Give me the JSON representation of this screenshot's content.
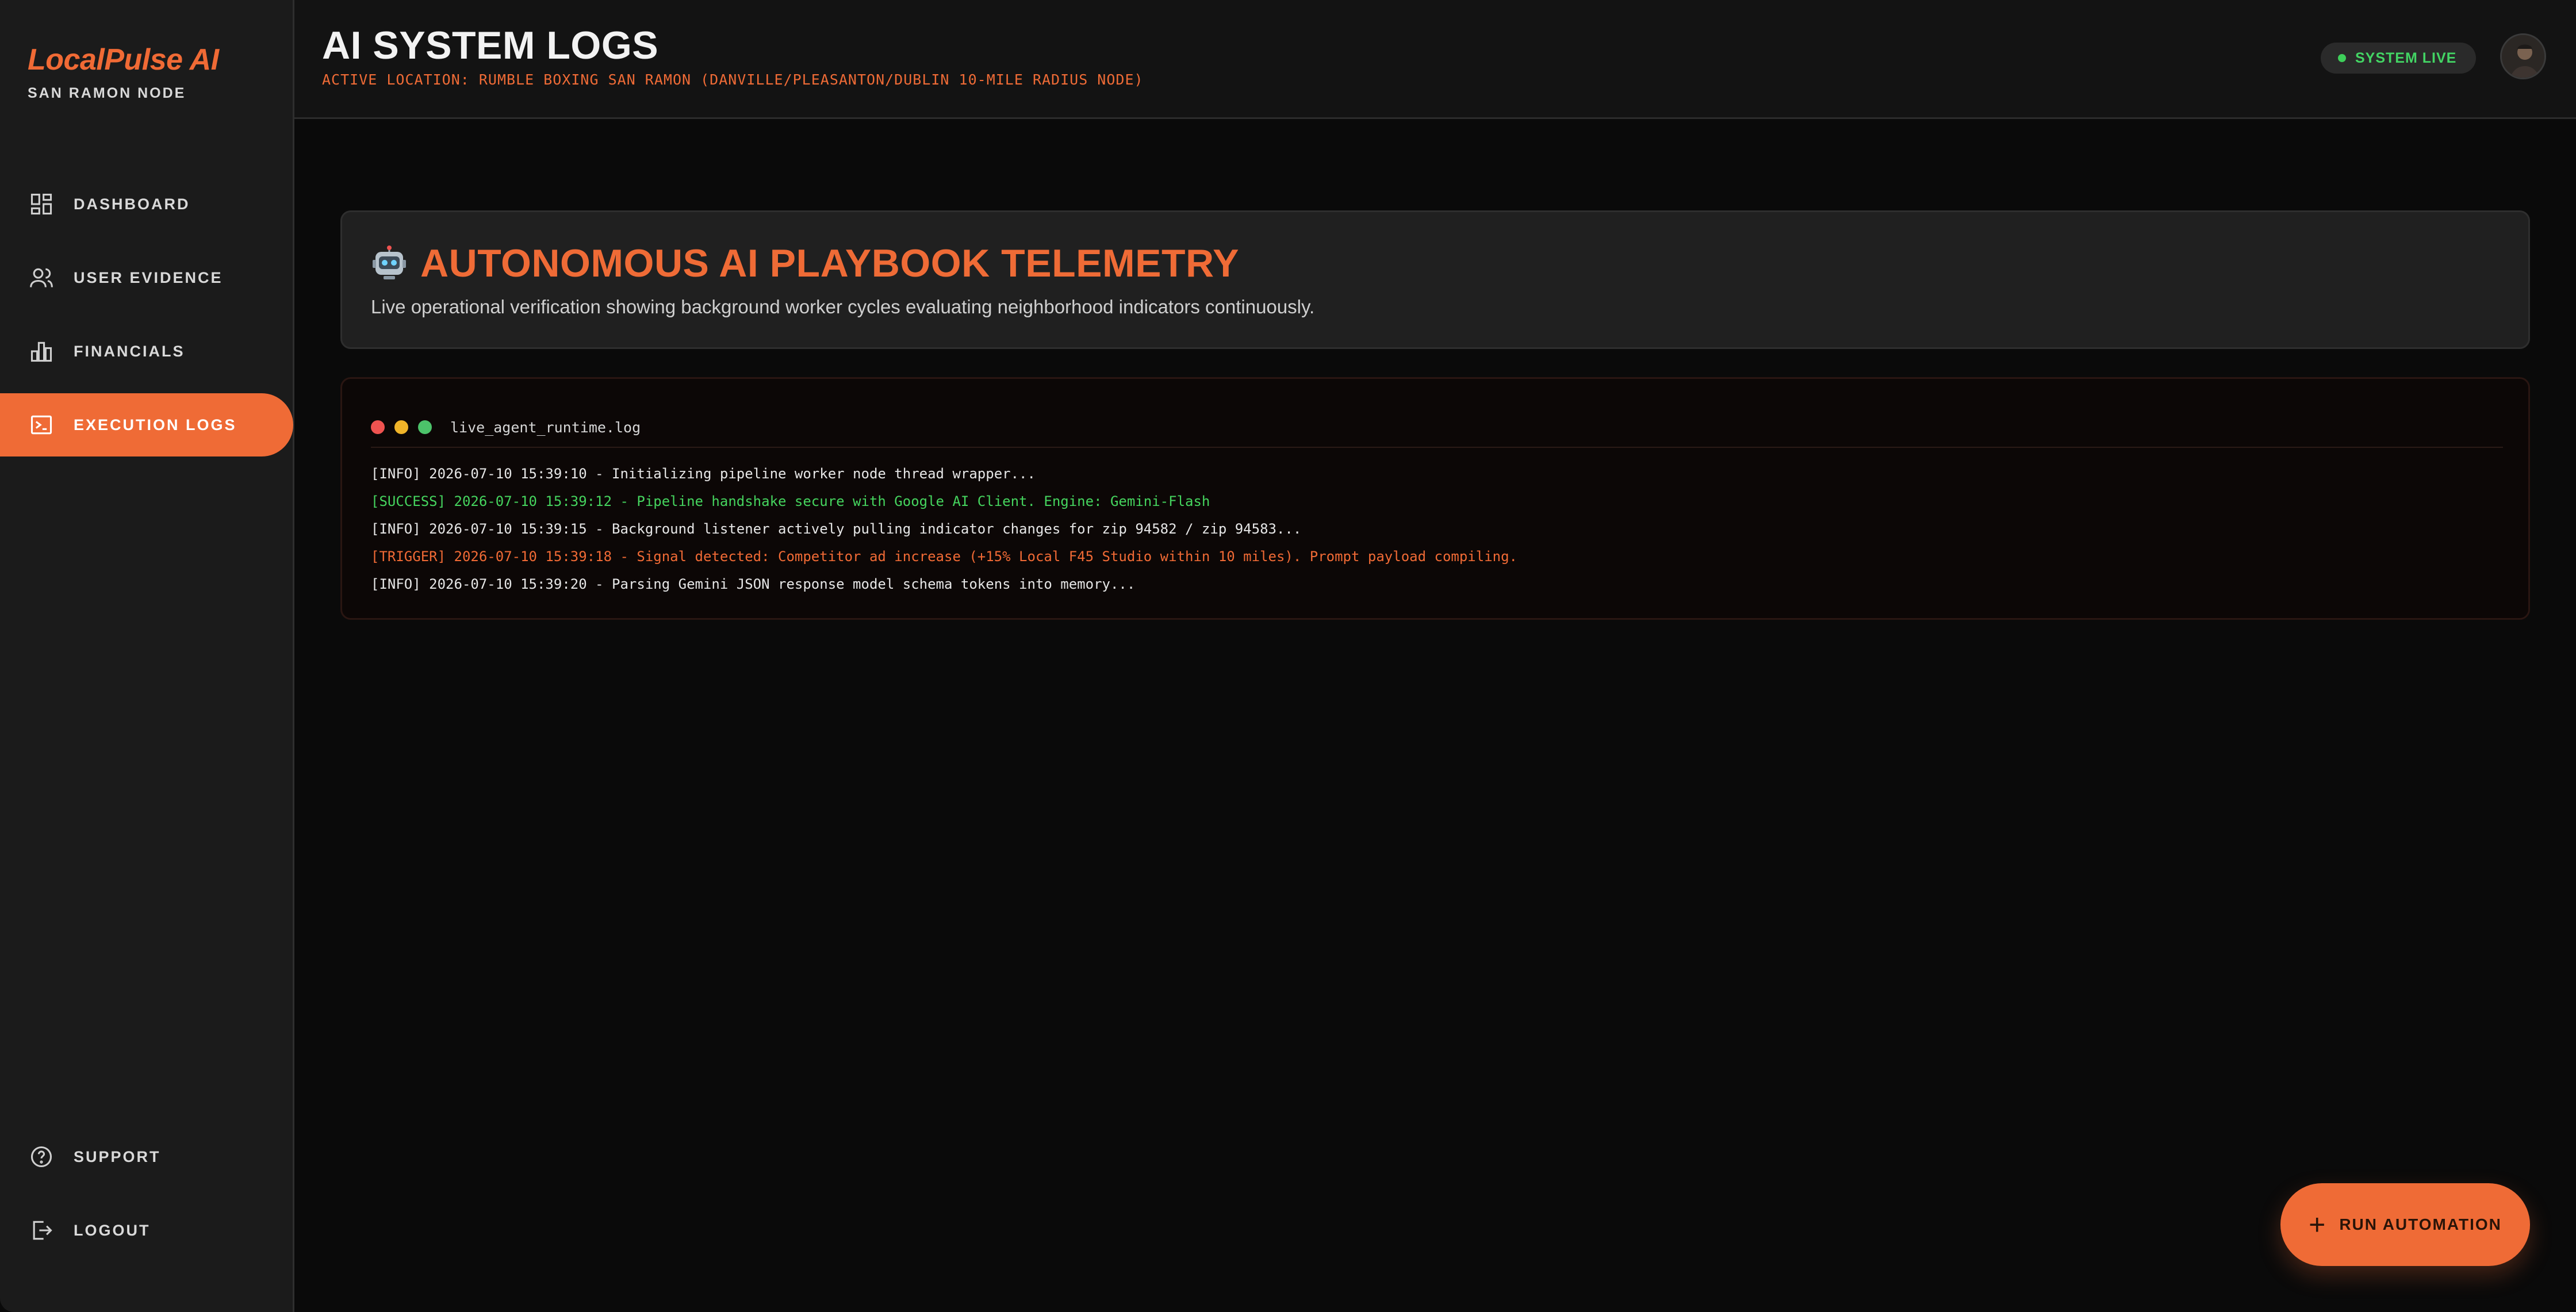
{
  "brand": {
    "name": "LocalPulse AI",
    "subtitle": "SAN RAMON NODE"
  },
  "nav": {
    "items": [
      {
        "label": "DASHBOARD",
        "icon": "dashboard-icon",
        "active": false
      },
      {
        "label": "USER EVIDENCE",
        "icon": "users-icon",
        "active": false
      },
      {
        "label": "FINANCIALS",
        "icon": "bar-chart-icon",
        "active": false
      },
      {
        "label": "EXECUTION LOGS",
        "icon": "terminal-icon",
        "active": true
      }
    ],
    "bottom": [
      {
        "label": "SUPPORT",
        "icon": "help-icon"
      },
      {
        "label": "LOGOUT",
        "icon": "logout-icon"
      }
    ]
  },
  "header": {
    "title": "AI SYSTEM LOGS",
    "subtitle": "ACTIVE LOCATION: RUMBLE BOXING SAN RAMON (DANVILLE/PLEASANTON/DUBLIN 10-MILE RADIUS NODE)",
    "status": "SYSTEM LIVE"
  },
  "hero": {
    "title": "AUTONOMOUS AI PLAYBOOK TELEMETRY",
    "description": "Live operational verification showing background worker cycles evaluating neighborhood indicators continuously."
  },
  "terminal": {
    "filename": "live_agent_runtime.log",
    "lines": [
      {
        "text": "[INFO] 2026-07-10 15:39:10 - Initializing pipeline worker node thread wrapper...",
        "level": "info"
      },
      {
        "text": "[SUCCESS] 2026-07-10 15:39:12 - Pipeline handshake secure with Google AI Client. Engine: Gemini-Flash",
        "level": "success"
      },
      {
        "text": "[INFO] 2026-07-10 15:39:15 - Background listener actively pulling indicator changes for zip 94582 / zip 94583...",
        "level": "info"
      },
      {
        "text": "[TRIGGER] 2026-07-10 15:39:18 - Signal detected: Competitor ad increase (+15% Local F45 Studio within 10 miles). Prompt payload compiling.",
        "level": "trigger"
      },
      {
        "text": "[INFO] 2026-07-10 15:39:20 - Parsing Gemini JSON response model schema tokens into memory...",
        "level": "info"
      }
    ]
  },
  "fab": {
    "label": "RUN AUTOMATION"
  },
  "colors": {
    "accent": "#ef6b36",
    "info": "#e6e6e6",
    "success": "#45d45e",
    "trigger": "#f06a35",
    "live": "#43d464",
    "dot_red": "#ef5350",
    "dot_yellow": "#f0b429",
    "dot_green": "#4cc36a"
  }
}
